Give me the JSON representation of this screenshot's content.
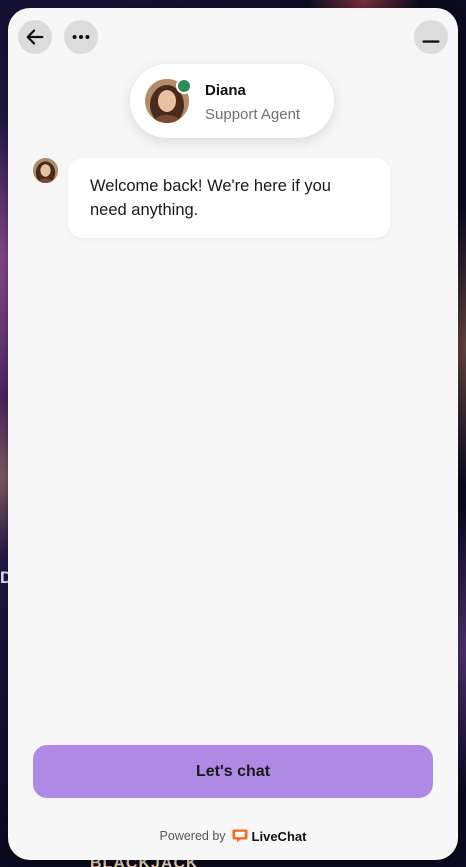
{
  "header": {
    "back_icon": "arrow-left-icon",
    "more_icon": "more-horizontal-icon",
    "minimize_icon": "minimize-icon"
  },
  "agent": {
    "name": "Diana",
    "role": "Support Agent",
    "status": "online",
    "status_color": "#2e8b57"
  },
  "messages": [
    {
      "from": "agent",
      "text": "Welcome back! We're here if you need anything."
    }
  ],
  "cta": {
    "label": "Let's chat",
    "color": "#ae8ae4"
  },
  "footer": {
    "powered_by": "Powered by",
    "brand": "LiveChat",
    "brand_color": "#f26b21"
  },
  "background": {
    "side_text": "D",
    "bottom_text": "BLACKJACK"
  }
}
